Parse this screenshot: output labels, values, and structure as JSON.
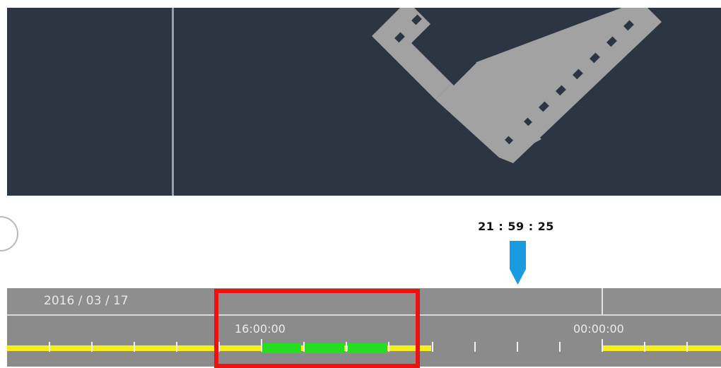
{
  "player": {
    "current_time": "21 : 59 : 25"
  },
  "timeline": {
    "date": "2016 / 03 / 17",
    "time_labels": [
      "16:00:00",
      "00:00:00"
    ]
  },
  "recording_segments": {
    "continuous_color": "#f5f01c",
    "event_color": "#22e01f"
  },
  "highlight": {
    "color": "#ee1111"
  },
  "icons": {
    "video_placeholder": "film-strip-icon",
    "playhead": "playhead-marker-icon",
    "prev_control": "circle-button"
  }
}
